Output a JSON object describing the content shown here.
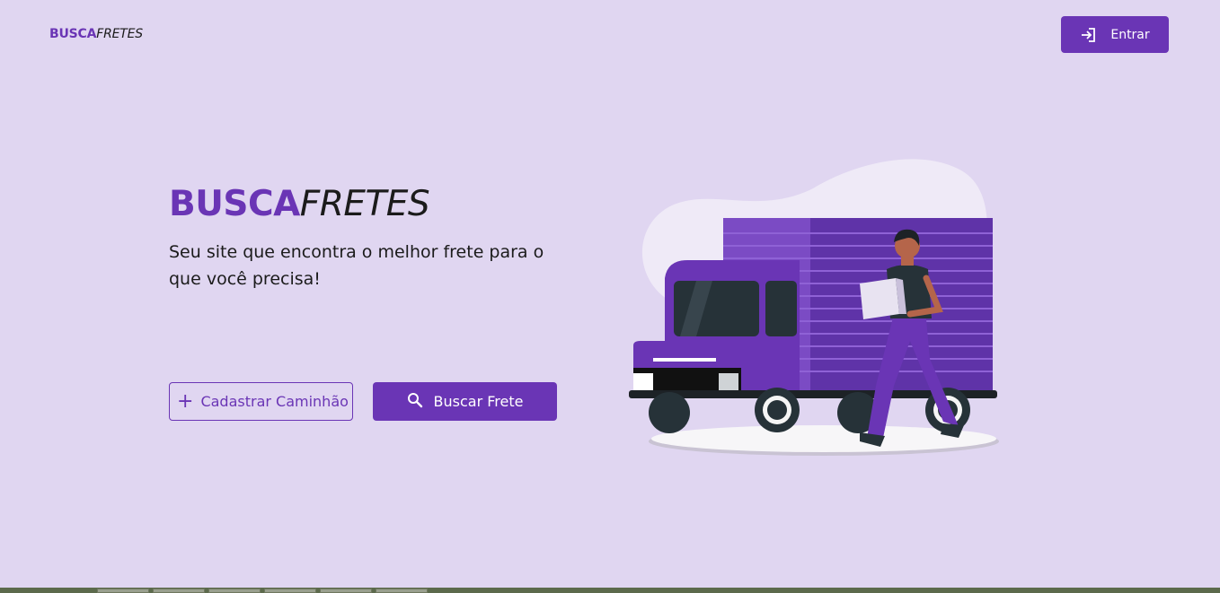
{
  "header": {
    "logo_bold": "BUSCA",
    "logo_italic": "FRETES",
    "login_label": "Entrar",
    "login_icon": "login-icon"
  },
  "hero": {
    "title_bold": "BUSCA",
    "title_italic": "FRETES",
    "subtitle": "Seu site que encontra o melhor frete para o que você precisa!",
    "register_button": {
      "icon": "plus-icon",
      "label": "Cadastrar Caminhão"
    },
    "search_button": {
      "icon": "search-icon",
      "label": "Buscar Frete"
    }
  },
  "illustration": {
    "name": "delivery-truck-illustration"
  },
  "colors": {
    "background": "#e0d6f1",
    "accent": "#6a35b5",
    "text": "#1b1b1b"
  }
}
